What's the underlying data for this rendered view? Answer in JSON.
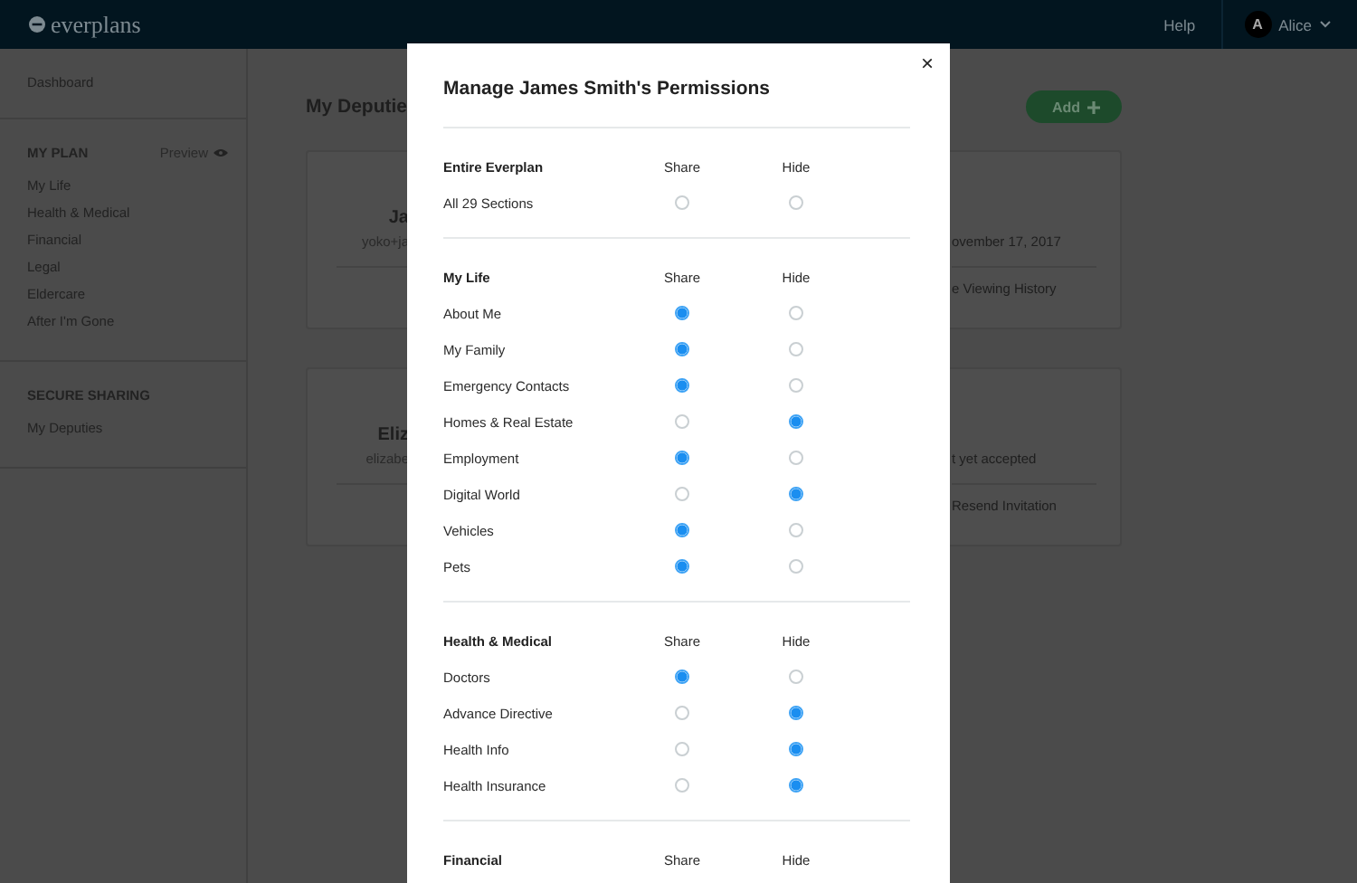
{
  "header": {
    "logo": "everplans",
    "help": "Help",
    "user": {
      "initial": "A",
      "name": "Alice"
    }
  },
  "sidebar": {
    "dashboard": "Dashboard",
    "groups": [
      {
        "title": "MY PLAN",
        "action": "Preview",
        "items": [
          "My Life",
          "Health & Medical",
          "Financial",
          "Legal",
          "Eldercare",
          "After I'm Gone"
        ]
      },
      {
        "title": "SECURE SHARING",
        "items": [
          "My Deputies"
        ]
      }
    ]
  },
  "main": {
    "title": "My Deputie",
    "add_button": "Add",
    "cards": [
      {
        "name": "Ja",
        "email": "yoko+ja",
        "status": "ovember 17, 2017",
        "action": "e Viewing History"
      },
      {
        "name": "Eliz",
        "email": "elizabe",
        "status": "t yet accepted",
        "action": "Resend Invitation"
      }
    ]
  },
  "modal": {
    "title": "Manage James Smith's Permissions",
    "close": "×",
    "sections": [
      {
        "title": "Entire Everplan",
        "columns": [
          "Share",
          "Hide"
        ],
        "rows": [
          {
            "label": "All 29 Sections",
            "choices": [
              {
                "selected": false
              },
              {
                "selected": false
              }
            ]
          }
        ]
      },
      {
        "title": "My Life",
        "columns": [
          "Share",
          "Hide"
        ],
        "rows": [
          {
            "label": "About Me",
            "choices": [
              {
                "selected": true
              },
              {
                "selected": false
              }
            ]
          },
          {
            "label": "My Family",
            "choices": [
              {
                "selected": true
              },
              {
                "selected": false
              }
            ]
          },
          {
            "label": "Emergency Contacts",
            "choices": [
              {
                "selected": true
              },
              {
                "selected": false
              }
            ]
          },
          {
            "label": "Homes & Real Estate",
            "choices": [
              {
                "selected": false
              },
              {
                "selected": true
              }
            ]
          },
          {
            "label": "Employment",
            "choices": [
              {
                "selected": true
              },
              {
                "selected": false
              }
            ]
          },
          {
            "label": "Digital World",
            "choices": [
              {
                "selected": false
              },
              {
                "selected": true
              }
            ]
          },
          {
            "label": "Vehicles",
            "choices": [
              {
                "selected": true
              },
              {
                "selected": false
              }
            ]
          },
          {
            "label": "Pets",
            "choices": [
              {
                "selected": true
              },
              {
                "selected": false
              }
            ]
          }
        ]
      },
      {
        "title": "Health & Medical",
        "columns": [
          "Share",
          "Hide"
        ],
        "rows": [
          {
            "label": "Doctors",
            "choices": [
              {
                "selected": true
              },
              {
                "selected": false
              }
            ]
          },
          {
            "label": "Advance Directive",
            "choices": [
              {
                "selected": false
              },
              {
                "selected": true
              }
            ]
          },
          {
            "label": "Health Info",
            "choices": [
              {
                "selected": false
              },
              {
                "selected": true
              }
            ]
          },
          {
            "label": "Health Insurance",
            "choices": [
              {
                "selected": false
              },
              {
                "selected": true
              }
            ]
          }
        ]
      },
      {
        "title": "Financial",
        "columns": [
          "Share",
          "Hide"
        ]
      }
    ]
  }
}
